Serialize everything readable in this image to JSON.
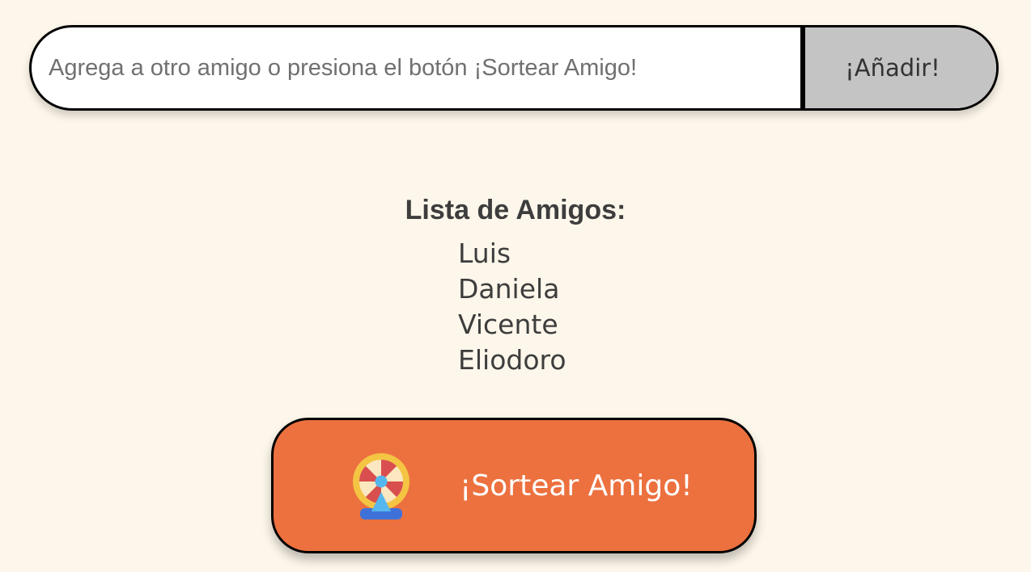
{
  "input": {
    "placeholder": "Agrega a otro amigo o presiona el botón ¡Sortear Amigo!",
    "value": ""
  },
  "add_button": {
    "label": "¡Añadir!"
  },
  "list": {
    "title": "Lista de Amigos:",
    "friends": [
      "Luis",
      "Daniela",
      "Vicente",
      "Eliodoro"
    ]
  },
  "draw_button": {
    "label": "¡Sortear Amigo!",
    "icon": "prize-wheel-icon"
  },
  "colors": {
    "background": "#fdf6ea",
    "draw_button": "#ec713f",
    "add_button": "#c4c4c4",
    "text": "#444444"
  }
}
